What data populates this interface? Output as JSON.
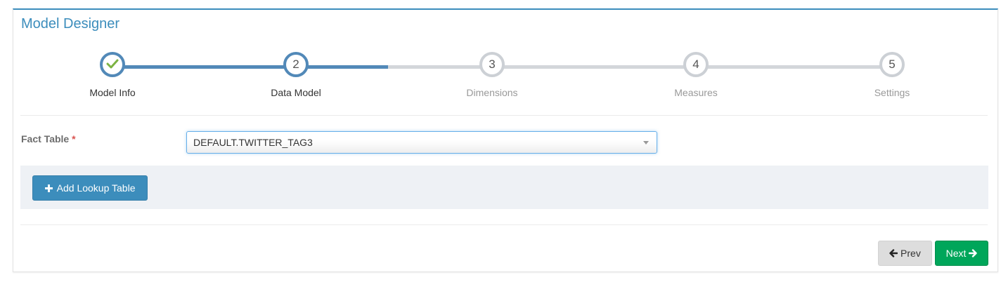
{
  "panel": {
    "title": "Model Designer"
  },
  "wizard": {
    "steps": [
      {
        "number": "1",
        "label": "Model Info",
        "state": "completed",
        "icon": "check-icon"
      },
      {
        "number": "2",
        "label": "Data Model",
        "state": "active"
      },
      {
        "number": "3",
        "label": "Dimensions",
        "state": "inactive"
      },
      {
        "number": "4",
        "label": "Measures",
        "state": "inactive"
      },
      {
        "number": "5",
        "label": "Settings",
        "state": "inactive"
      }
    ]
  },
  "form": {
    "fact_table_label": "Fact Table",
    "required_marker": "*",
    "fact_table_value": "DEFAULT.TWITTER_TAG3"
  },
  "lookup": {
    "add_button_icon": "plus-icon",
    "add_button_label": "Add Lookup Table"
  },
  "footer": {
    "prev_label": "Prev",
    "prev_icon": "arrow-left-icon",
    "next_label": "Next",
    "next_icon": "arrow-right-icon"
  },
  "colors": {
    "primary": "#3c8dbc",
    "wizard_active": "#5289b8",
    "wizard_inactive": "#ccd0d5",
    "check": "#7cb342",
    "success": "#00a65a",
    "required": "#d9534f"
  }
}
